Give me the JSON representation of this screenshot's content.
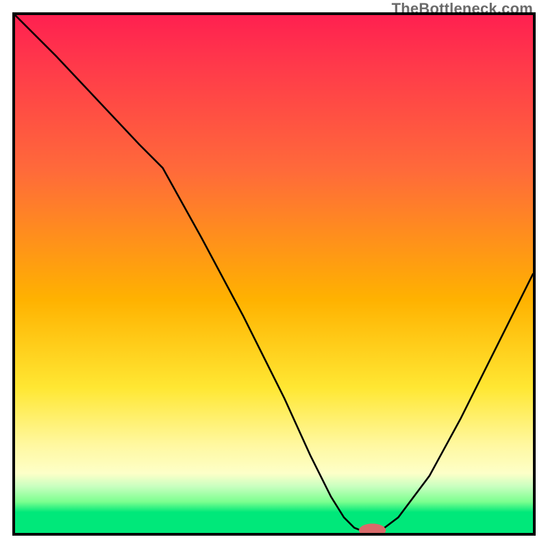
{
  "watermark": "TheBottleneck.com",
  "chart_data": {
    "type": "line",
    "title": "",
    "xlabel": "",
    "ylabel": "",
    "xlim": [
      0,
      100
    ],
    "ylim": [
      0,
      100
    ],
    "grid": false,
    "legend": false,
    "x": [
      0,
      8,
      16,
      24,
      28.5,
      36,
      44,
      52,
      57,
      61,
      63.5,
      65.5,
      68,
      70,
      74,
      80,
      86,
      92,
      100
    ],
    "values": [
      100,
      92,
      83.5,
      75,
      70.5,
      57,
      42,
      26,
      15,
      7,
      3,
      1,
      0,
      0,
      3,
      11,
      22,
      34,
      50
    ],
    "marker": {
      "x": 69,
      "y": 0.5,
      "rx": 2.6,
      "ry": 1.3,
      "color": "#d96a6a"
    },
    "gradient_stops": [
      {
        "pos": 0.0,
        "color": "#ff2050"
      },
      {
        "pos": 0.55,
        "color": "#ffb200"
      },
      {
        "pos": 0.83,
        "color": "#fff8a0"
      },
      {
        "pos": 0.96,
        "color": "#00e87a"
      }
    ]
  }
}
